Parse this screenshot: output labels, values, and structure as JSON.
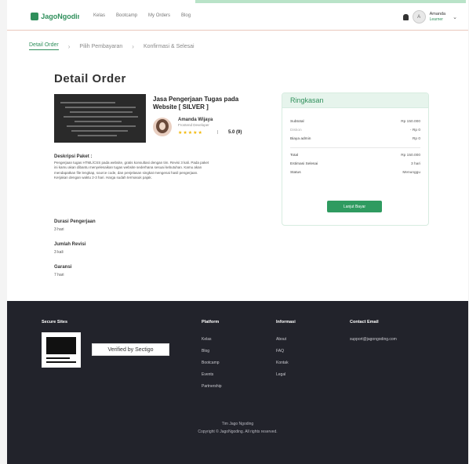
{
  "header": {
    "logo_text": "JagoNgoding",
    "nav": [
      "Kelas",
      "Bootcamp",
      "My Orders",
      "Blog"
    ],
    "user_name": "Amanda",
    "user_role": "Learner",
    "avatar_initial": "A"
  },
  "steps": [
    "Detail Order",
    "Pilih Pembayaran",
    "Konfirmasi & Selesai"
  ],
  "page_title": "Detail Order",
  "course": {
    "title": "Jasa Pengerjaan Tugas pada Website [ SILVER ]",
    "mentor_name": "Amanda Wijaya",
    "mentor_sub": "Frontend Developer",
    "stars": "★★★★★",
    "rating_sep": "|",
    "rating": "5.0 (9)"
  },
  "description": {
    "heading": "Deskripsi Paket :",
    "text": "Pengerjaan tugas HTML/CSS pada website, gratis konsultasi dengan tim. Revisi 3 kali. Pada paket ini kamu akan dibantu menyelesaikan tugas website sederhana sesuai kebutuhan. Kamu akan mendapatkan file lengkap, source code, dan penjelasan singkat mengenai hasil pengerjaan. Kerjakan dengan waktu 2-3 hari. Harga sudah termasuk pajak."
  },
  "info": [
    {
      "label": "Durasi Pengerjaan",
      "value": "3 hari"
    },
    {
      "label": "Jumlah Revisi",
      "value": "3 kali"
    },
    {
      "label": "Garansi",
      "value": "7 hari"
    }
  ],
  "summary": {
    "title": "Ringkasan",
    "rows": [
      {
        "label": "Subtotal",
        "value": "Rp 150.000"
      },
      {
        "label": "Diskon",
        "value": "- Rp 0"
      },
      {
        "label": "Biaya admin",
        "value": "Rp 0"
      }
    ],
    "rows2": [
      {
        "label": "Total",
        "value": "Rp 150.000"
      },
      {
        "label": "Estimasi Selesai",
        "value": "3 hari"
      },
      {
        "label": "Status",
        "value": "Menunggu"
      }
    ],
    "button": "Lanjut Bayar"
  },
  "footer": {
    "brand_heading": "Secure Sites",
    "badge_text": "Verified by Sectigo",
    "col1": {
      "title": "Platform",
      "links": [
        "Kelas",
        "Blog",
        "Bootcamp",
        "Events",
        "Partnership"
      ]
    },
    "col2": {
      "title": "Informasi",
      "links": [
        "About",
        "FAQ",
        "Kontak",
        "Legal"
      ]
    },
    "col3": {
      "title": "Contact Email",
      "email": "support@jagongoding.com"
    },
    "bottom1": "Tim Jago Ngoding",
    "bottom2": "Copyright © JagoNgoding. All rights reserved."
  },
  "colors": {
    "accent": "#2f8f5b",
    "footer_bg": "#22232b",
    "button": "#2f9b60"
  }
}
